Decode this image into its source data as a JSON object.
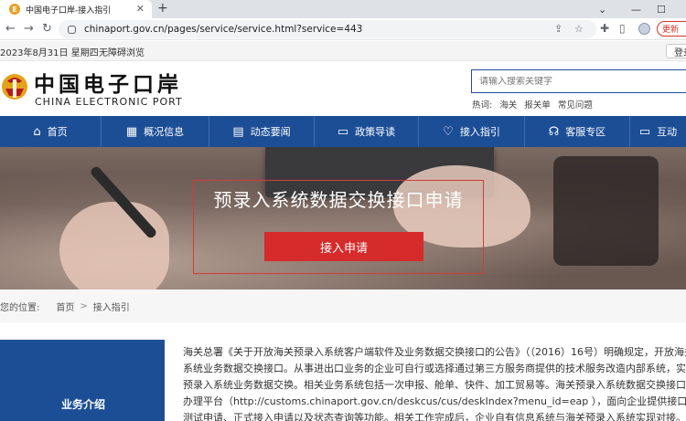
{
  "browser": {
    "tab_title": "中国电子口岸-接入指引",
    "tab_favicon": "E",
    "url": "chinaport.gov.cn/pages/service/service.html?service=443",
    "update_label": "更新"
  },
  "infobar": {
    "date": "2023年8月31日 星期四",
    "accessibility": "无障碍浏览",
    "login": "登录"
  },
  "header": {
    "logo_cn": "中国电子口岸",
    "logo_en": "CHINA ELECTRONIC PORT",
    "search_placeholder": "请输入搜索关键字",
    "hot_label": "热词:",
    "hot_words": [
      "海关",
      "报关单",
      "常见问题"
    ]
  },
  "nav": {
    "items": [
      {
        "label": "首页",
        "icon": "home-icon"
      },
      {
        "label": "概况信息",
        "icon": "chart-icon"
      },
      {
        "label": "动态要闻",
        "icon": "news-icon"
      },
      {
        "label": "政策导读",
        "icon": "book-icon"
      },
      {
        "label": "接入指引",
        "icon": "heart-icon"
      },
      {
        "label": "客服专区",
        "icon": "headset-icon"
      },
      {
        "label": "互动",
        "icon": "chat-icon"
      }
    ]
  },
  "banner": {
    "title": "预录入系统数据交换接口申请",
    "button": "接入申请"
  },
  "breadcrumb": {
    "label": "您的位置:",
    "home": "首页",
    "sep": ">",
    "current": "接入指引"
  },
  "sidebar": {
    "title": "业务介绍"
  },
  "article": {
    "lines": [
      "海关总署《关于开放海关预录入系统客户端软件及业务数据交换接口的公告》（（2016）16号）明确规定，开放海关预",
      "系统业务数据交换接口。从事进出口业务的企业可自行或选择通过第三方服务商提供的技术服务改造内部系统，实现",
      "预录入系统业务数据交换。相关业务系统包括一次申报、舱单、快件、加工贸易等。海关预录入系统数据交换接口申",
      "办理平台（http://customs.chinaport.gov.cn/deskcus/cus/deskIndex?menu_id=eap ），面向企业提供接口申请、",
      "测试申请、正式接入申请以及状态查询等功能。相关工作完成后，企业自有信息系统与海关预录入系统实现对接。企"
    ]
  }
}
